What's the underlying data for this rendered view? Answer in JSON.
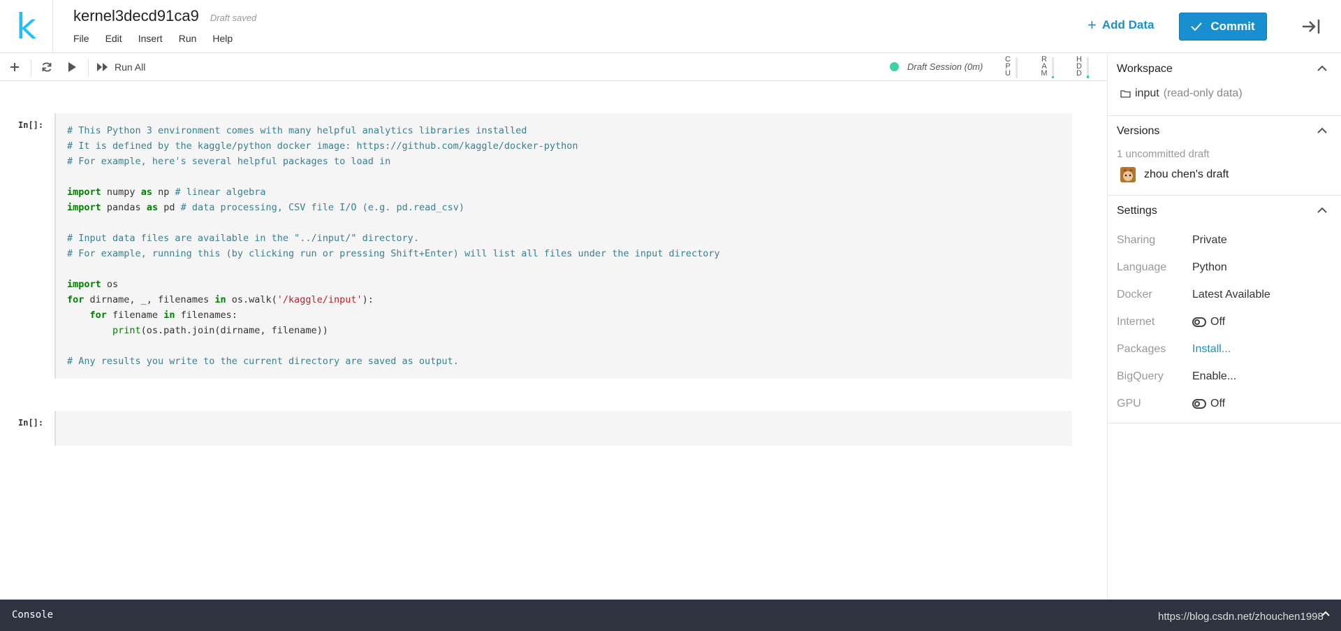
{
  "header": {
    "logo": "k",
    "title": "kernel3decd91ca9",
    "draft_status": "Draft saved",
    "menu": [
      "File",
      "Edit",
      "Insert",
      "Run",
      "Help"
    ],
    "add_data_label": "Add Data",
    "commit_label": "Commit"
  },
  "toolbar": {
    "run_all_label": "Run All",
    "session_text": "Draft Session (0m)",
    "meters": [
      {
        "label": "CPU",
        "level": 0
      },
      {
        "label": "RAM",
        "level": 0.1
      },
      {
        "label": "HDD",
        "level": 0.15
      }
    ],
    "colors": {
      "session": "#3fd0a7",
      "accent": "#1a8fd0"
    }
  },
  "cells": [
    {
      "prompt": "In[]:"
    },
    {
      "prompt": "In[]:"
    }
  ],
  "code_lines": [
    [
      "# This Python 3 environment comes with many helpful analytics libraries installed"
    ],
    [
      "# It is defined by the kaggle/python docker image: https://github.com/kaggle/docker-python"
    ],
    [
      "# For example, here's several helpful packages to load in"
    ],
    [
      ""
    ],
    [
      "import",
      " numpy ",
      "as",
      " np ",
      "# linear algebra"
    ],
    [
      "import",
      " pandas ",
      "as",
      " pd ",
      "# data processing, CSV file I/O (e.g. pd.read_csv)"
    ],
    [
      ""
    ],
    [
      "# Input data files are available in the \"../input/\" directory."
    ],
    [
      "# For example, running this (by clicking run or pressing Shift+Enter) will list all files under the input directory"
    ],
    [
      ""
    ],
    [
      "import",
      " os"
    ],
    [
      "for",
      " dirname, _, filenames ",
      "in",
      " os.walk(",
      "'/kaggle/input'",
      "):"
    ],
    [
      "    ",
      "for",
      " filename ",
      "in",
      " filenames:"
    ],
    [
      "        ",
      "print",
      "(os.path.join(dirname, filename))"
    ],
    [
      ""
    ],
    [
      "# Any results you write to the current directory are saved as output."
    ]
  ],
  "sidebar": {
    "workspace": {
      "title": "Workspace",
      "item": "input",
      "item_note": "(read-only data)"
    },
    "versions": {
      "title": "Versions",
      "subtitle": "1 uncommitted draft",
      "draft": "zhou chen's draft"
    },
    "settings": {
      "title": "Settings",
      "rows": [
        {
          "label": "Sharing",
          "value": "Private"
        },
        {
          "label": "Language",
          "value": "Python"
        },
        {
          "label": "Docker",
          "value": "Latest Available"
        },
        {
          "label": "Internet",
          "value": "Off"
        },
        {
          "label": "Packages",
          "value": "Install..."
        },
        {
          "label": "BigQuery",
          "value": "Enable..."
        },
        {
          "label": "GPU",
          "value": "Off"
        }
      ]
    }
  },
  "console": {
    "label": "Console",
    "watermark": "https://blog.csdn.net/zhouchen1998"
  }
}
